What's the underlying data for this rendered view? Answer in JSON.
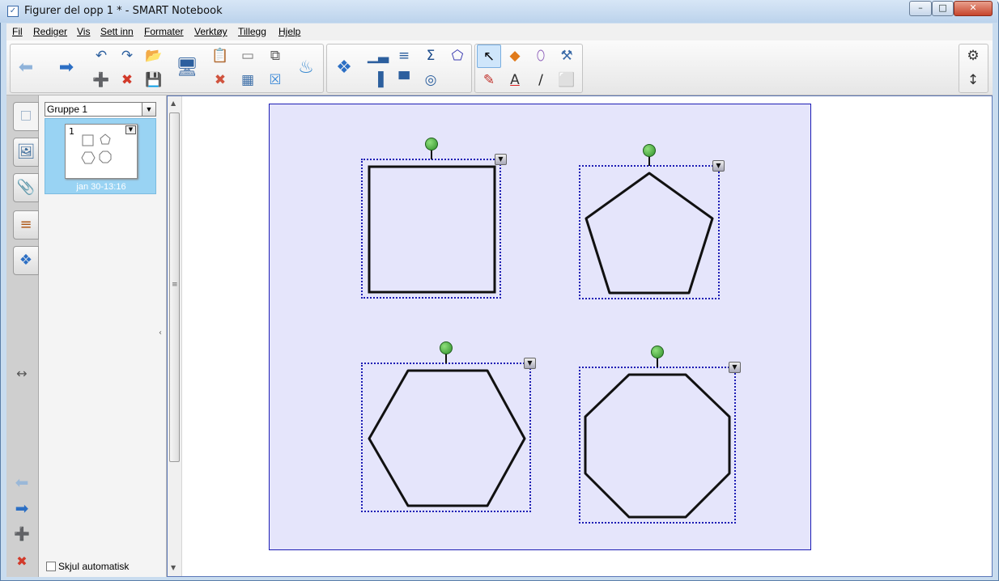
{
  "window": {
    "title": "Figurer del opp 1 * - SMART Notebook",
    "min": "–",
    "max": "□",
    "close": "✕"
  },
  "menu": [
    "Fil",
    "Rediger",
    "Vis",
    "Sett inn",
    "Formater",
    "Verktøy",
    "Tillegg",
    "Hjelp"
  ],
  "toolbar": {
    "back": "⬅",
    "forward": "➡",
    "undo": "↶",
    "redo": "↷",
    "open": "📂",
    "new_page": "➕",
    "delete_page": "✖",
    "save": "💾",
    "screen": "🖥",
    "paste": "📋",
    "screenshade": "▭",
    "capture": "⧉",
    "delete": "✖",
    "table": "▦",
    "fullscreen": "☒",
    "response": "♨",
    "addon": "❖",
    "math1": "▁▃",
    "math2": "≡",
    "sum": "Σ",
    "geo": "⬠",
    "align_left": "▐",
    "align_top": "▀",
    "measure": "◎",
    "select": "↖",
    "shapes": "◆",
    "eraser_shape": "⬯",
    "fill": "⚒",
    "pens": "✎",
    "text": "A",
    "line": "∕",
    "eraser": "⬜",
    "settings": "⚙",
    "move_toolbar": "↕"
  },
  "sidebar": {
    "tabs": [
      "🗆",
      "🖼",
      "📎",
      "≡",
      "❖"
    ],
    "move_icon": "↔",
    "prev": "⬅",
    "next": "➡",
    "add_page": "➕",
    "delete_page": "✖"
  },
  "sorter": {
    "group": "Gruppe 1",
    "dropdown_arrow": "▼",
    "page_number": "1",
    "page_date": "jan 30-13:16",
    "autohide_label": "Skjul automatisk"
  },
  "canvas": {
    "shape_menu_arrow": "▼",
    "shapes": [
      "square",
      "pentagon",
      "hexagon",
      "octagon"
    ]
  }
}
